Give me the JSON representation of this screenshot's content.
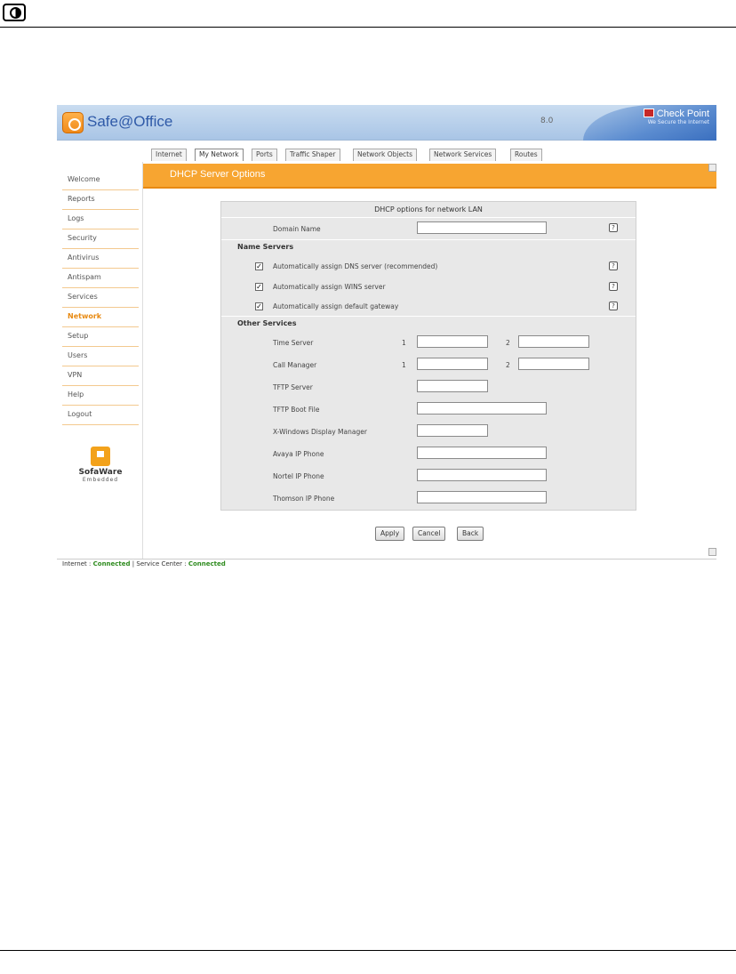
{
  "page_icon": "document-mark-icon",
  "app": {
    "brand": "Safe@Office",
    "version": "8.0",
    "vendor": "Check Point",
    "vendor_tagline": "We Secure the Internet",
    "colors": {
      "accent": "#f7a531",
      "header": "#a9c5e6",
      "link_active": "#e88a12",
      "status_ok": "#2e8b1e"
    }
  },
  "tabs": [
    "Internet",
    "My Network",
    "Ports",
    "Traffic Shaper",
    "Network Objects",
    "Network Services",
    "Routes"
  ],
  "active_tab": "My Network",
  "sidebar": {
    "items": [
      "Welcome",
      "Reports",
      "Logs",
      "Security",
      "Antivirus",
      "Antispam",
      "Services",
      "Network",
      "Setup",
      "Users",
      "VPN",
      "Help",
      "Logout"
    ],
    "active": "Network",
    "logo_name": "SofaWare",
    "logo_sub": "Embedded"
  },
  "page_title": "DHCP Server Options",
  "form": {
    "header": "DHCP options for network LAN",
    "domain_name_label": "Domain Name",
    "domain_name_value": "",
    "name_servers_heading": "Name Servers",
    "checkboxes": [
      {
        "label": "Automatically assign DNS server (recommended)",
        "checked": true
      },
      {
        "label": "Automatically assign WINS server",
        "checked": true
      },
      {
        "label": "Automatically assign default gateway",
        "checked": true
      }
    ],
    "other_services_heading": "Other Services",
    "time_server_label": "Time Server",
    "call_manager_label": "Call Manager",
    "index_1": "1",
    "index_2": "2",
    "tftp_server_label": "TFTP Server",
    "tftp_boot_file_label": "TFTP Boot File",
    "xwindows_label": "X-Windows Display Manager",
    "avaya_label": "Avaya IP Phone",
    "nortel_label": "Nortel IP Phone",
    "thomson_label": "Thomson IP Phone"
  },
  "buttons": {
    "apply": "Apply",
    "cancel": "Cancel",
    "back": "Back"
  },
  "status": {
    "internet_label": "Internet :",
    "internet_value": "Connected",
    "separator": "|",
    "service_center_label": "Service Center :",
    "service_center_value": "Connected"
  }
}
